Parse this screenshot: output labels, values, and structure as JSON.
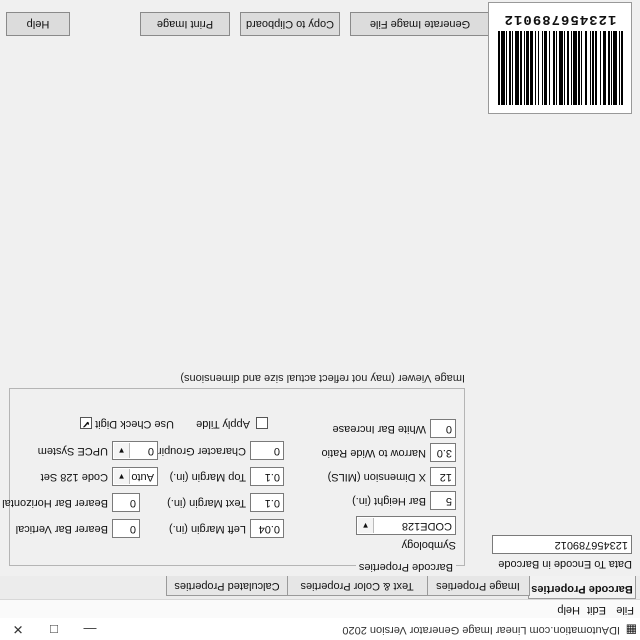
{
  "window": {
    "title": "IDAutomation.com Linear Image Generator Version 2020",
    "controls": [
      "—",
      "□",
      "✕"
    ]
  },
  "menu": [
    "File",
    "Edit",
    "Help"
  ],
  "tabs": [
    "Barcode Properties",
    "Image Properties",
    "Text & Color Properties",
    "Calculated Properties"
  ],
  "data_to_encode": {
    "label": "Data To Encode in Barcode",
    "value": "123456789012"
  },
  "barcode_properties": {
    "group_label": "Barcode Properties",
    "symbology_label": "Symbology",
    "symbology_value": "CODE128",
    "bar_height_label": "Bar Height (in.)",
    "bar_height_value": "5",
    "x_dimension_label": "X Dimension (MILS)",
    "x_dimension_value": "12",
    "narrow_wide_label": "Narrow to Wide Ratio",
    "narrow_wide_value": "3.0",
    "white_bar_label": "White Bar Increase",
    "white_bar_value": "0",
    "left_margin_label": "Left Margin (in.)",
    "left_margin_value": "0.04",
    "text_margin_label": "Text Margin (in.)",
    "text_margin_value": "0.1",
    "top_margin_label": "Top Margin (in.)",
    "top_margin_value": "0.1",
    "char_grouping_label": "Character Grouping",
    "char_grouping_value": "0",
    "apply_tilde_label": "Apply Tilde",
    "apply_tilde_checked": false,
    "bearer_vertical_label": "Bearer Bar Vertical",
    "bearer_vertical_value": "0",
    "bearer_horizontal_label": "Bearer Bar Horizontal",
    "bearer_horizontal_value": "0",
    "code128_set_label": "Code 128 Set",
    "code128_set_value": "Auto",
    "upce_label": "UPCE System",
    "upce_value": "0",
    "check_digit_label": "Use Check Digit",
    "check_digit_checked": true
  },
  "buttons": {
    "generate": "Generate Image File",
    "copy": "Copy to Clipboard",
    "print": "Print Image",
    "help": "Help"
  },
  "note": "Image Viewer (may not reflect actual size and dimensions)",
  "barcode_image": {
    "human_readable": "123456789012",
    "bars": [
      2,
      1,
      1,
      2,
      3,
      1,
      1,
      1,
      2,
      2,
      3,
      1,
      1,
      3,
      2,
      1,
      2,
      1,
      1,
      2,
      2,
      3,
      1,
      1,
      2,
      1,
      3,
      1,
      1,
      2,
      2,
      2,
      1,
      1,
      3,
      2,
      1,
      1,
      2,
      3,
      1,
      2,
      2,
      1,
      1,
      3,
      1,
      2,
      1,
      2,
      2,
      1,
      3,
      1,
      1,
      2,
      2,
      1,
      3,
      2,
      1,
      1,
      2,
      2,
      1,
      1,
      3,
      1,
      2,
      1
    ]
  }
}
